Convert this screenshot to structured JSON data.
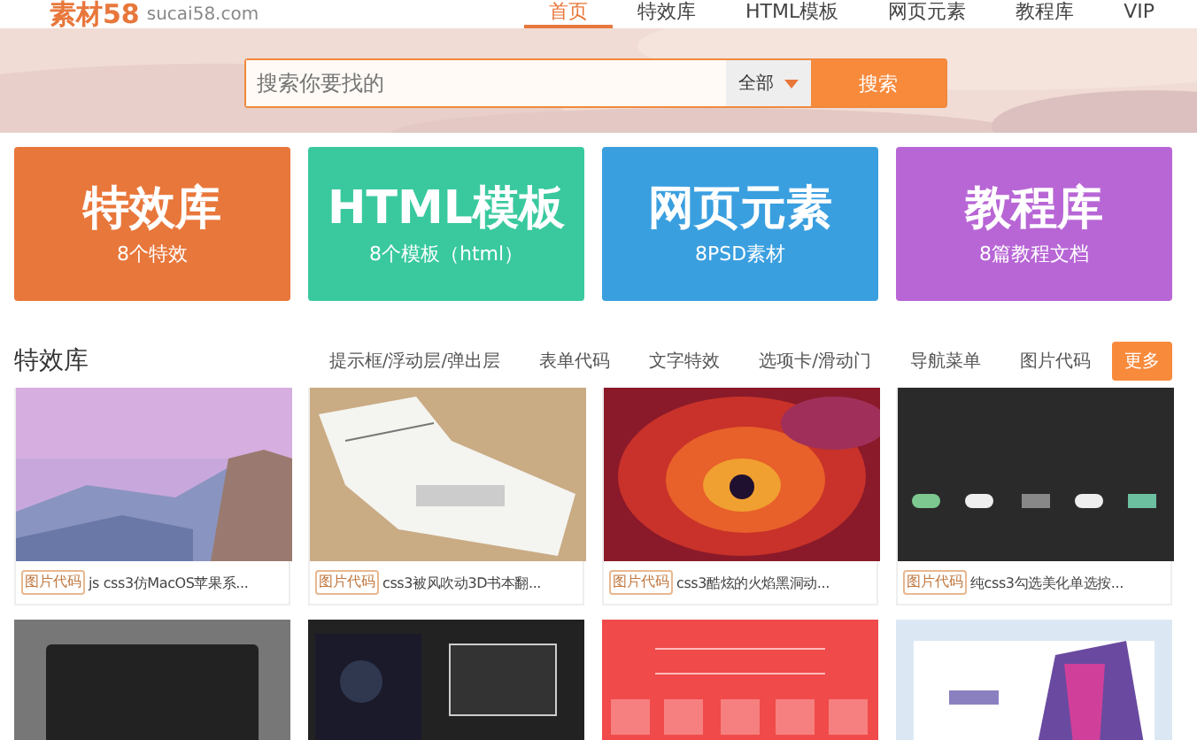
{
  "header": {
    "logo": "素材58",
    "domain": "sucai58.com",
    "nav": [
      {
        "label": "首页",
        "selected": true
      },
      {
        "label": "特效库",
        "selected": false
      },
      {
        "label": "HTML模板",
        "selected": false
      },
      {
        "label": "网页元素",
        "selected": false
      },
      {
        "label": "教程库",
        "selected": false
      },
      {
        "label": "VIP",
        "selected": false
      }
    ]
  },
  "search": {
    "placeholder": "搜索你要找的",
    "scope": "全部",
    "button": "搜索"
  },
  "categories": [
    {
      "title": "特效库",
      "subtitle": "8个特效",
      "color": "#e8773b"
    },
    {
      "title": "HTML模板",
      "subtitle": "8个模板（html）",
      "color": "#3ac99f"
    },
    {
      "title": "网页元素",
      "subtitle": "8PSD素材",
      "color": "#3a9fdf"
    },
    {
      "title": "教程库",
      "subtitle": "8篇教程文档",
      "color": "#b866d6"
    }
  ],
  "section": {
    "title": "特效库",
    "tabs": [
      "提示框/浮动层/弹出层",
      "表单代码",
      "文字特效",
      "选项卡/滑动门",
      "导航菜单",
      "图片代码"
    ],
    "more": "更多"
  },
  "items": [
    {
      "tag": "图片代码",
      "title": "js css3仿MacOS苹果系...",
      "kind": "mountain"
    },
    {
      "tag": "图片代码",
      "title": "css3被风吹动3D书本翻...",
      "kind": "paper"
    },
    {
      "tag": "图片代码",
      "title": "css3酷炫的火焰黑洞动...",
      "kind": "fire"
    },
    {
      "tag": "图片代码",
      "title": "纯css3勾选美化单选按...",
      "kind": "dark"
    }
  ],
  "items_row2": [
    {
      "kind": "grey"
    },
    {
      "kind": "night"
    },
    {
      "kind": "red"
    },
    {
      "kind": "pale"
    }
  ]
}
